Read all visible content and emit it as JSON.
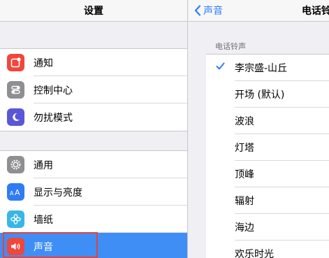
{
  "left": {
    "title": "设置",
    "group1": [
      {
        "label": "通知",
        "icon": "notifications-icon",
        "color": "#f0463c"
      },
      {
        "label": "控制中心",
        "icon": "control-center-icon",
        "color": "#8e8e93"
      },
      {
        "label": "勿扰模式",
        "icon": "moon-icon",
        "color": "#5a57d6"
      }
    ],
    "group2": [
      {
        "label": "通用",
        "icon": "gear-icon",
        "color": "#8e8e93"
      },
      {
        "label": "显示与亮度",
        "icon": "display-brightness-icon",
        "color": "#2f7cf6"
      },
      {
        "label": "墙纸",
        "icon": "wallpaper-icon",
        "color": "#38b6e8"
      },
      {
        "label": "声音",
        "icon": "speaker-icon",
        "color": "#f0463c",
        "selected": true
      }
    ]
  },
  "right": {
    "back_label": "声音",
    "title": "电话铃",
    "section_label": "电话铃声",
    "tones": [
      "李宗盛-山丘",
      "开场 (默认)",
      "波浪",
      "灯塔",
      "顶峰",
      "辐射",
      "海边",
      "欢乐时光"
    ],
    "selected_index": 0
  },
  "colors": {
    "accent": "#2f7cf6",
    "selected_row": "#3f8ef5",
    "highlight_border": "#e0433f"
  }
}
